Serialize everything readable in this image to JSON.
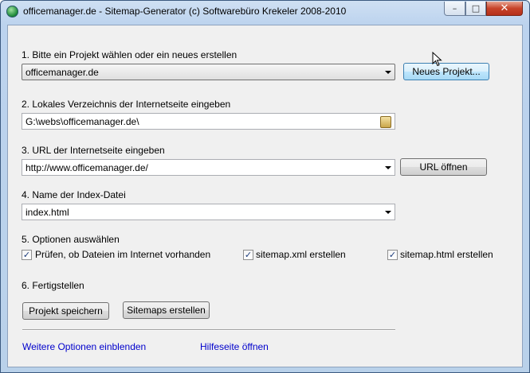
{
  "window": {
    "title": "officemanager.de - Sitemap-Generator (c) Softwarebüro Krekeler 2008-2010",
    "controls": {
      "minimize": "–",
      "maximize": "□",
      "close": "✕"
    }
  },
  "step1": {
    "label": "1. Bitte ein Projekt wählen oder ein neues erstellen",
    "project_value": "officemanager.de",
    "new_project_button": "Neues Projekt..."
  },
  "step2": {
    "label": "2. Lokales Verzeichnis der Internetseite eingeben",
    "path_value": "G:\\webs\\officemanager.de\\"
  },
  "step3": {
    "label": "3. URL der Internetseite eingeben",
    "url_value": "http://www.officemanager.de/",
    "open_url_button": "URL öffnen"
  },
  "step4": {
    "label": "4. Name der Index-Datei",
    "index_value": "index.html"
  },
  "step5": {
    "label": "5. Optionen auswählen",
    "options": [
      {
        "label": "Prüfen, ob Dateien im Internet vorhanden",
        "checked": true
      },
      {
        "label": "sitemap.xml erstellen",
        "checked": true
      },
      {
        "label": "sitemap.html erstellen",
        "checked": true
      }
    ]
  },
  "step6": {
    "label": "6. Fertigstellen",
    "save_button": "Projekt speichern",
    "create_button": "Sitemaps erstellen"
  },
  "footer": {
    "more_options_link": "Weitere Optionen einblenden",
    "help_link": "Hilfeseite öffnen"
  },
  "colors": {
    "link": "#0000cc",
    "accent_border": "#3c7fb1",
    "close_button": "#c7432a"
  },
  "icons": {
    "app": "globe-icon",
    "folder": "folder-icon",
    "cursor": "mouse-pointer-icon"
  }
}
